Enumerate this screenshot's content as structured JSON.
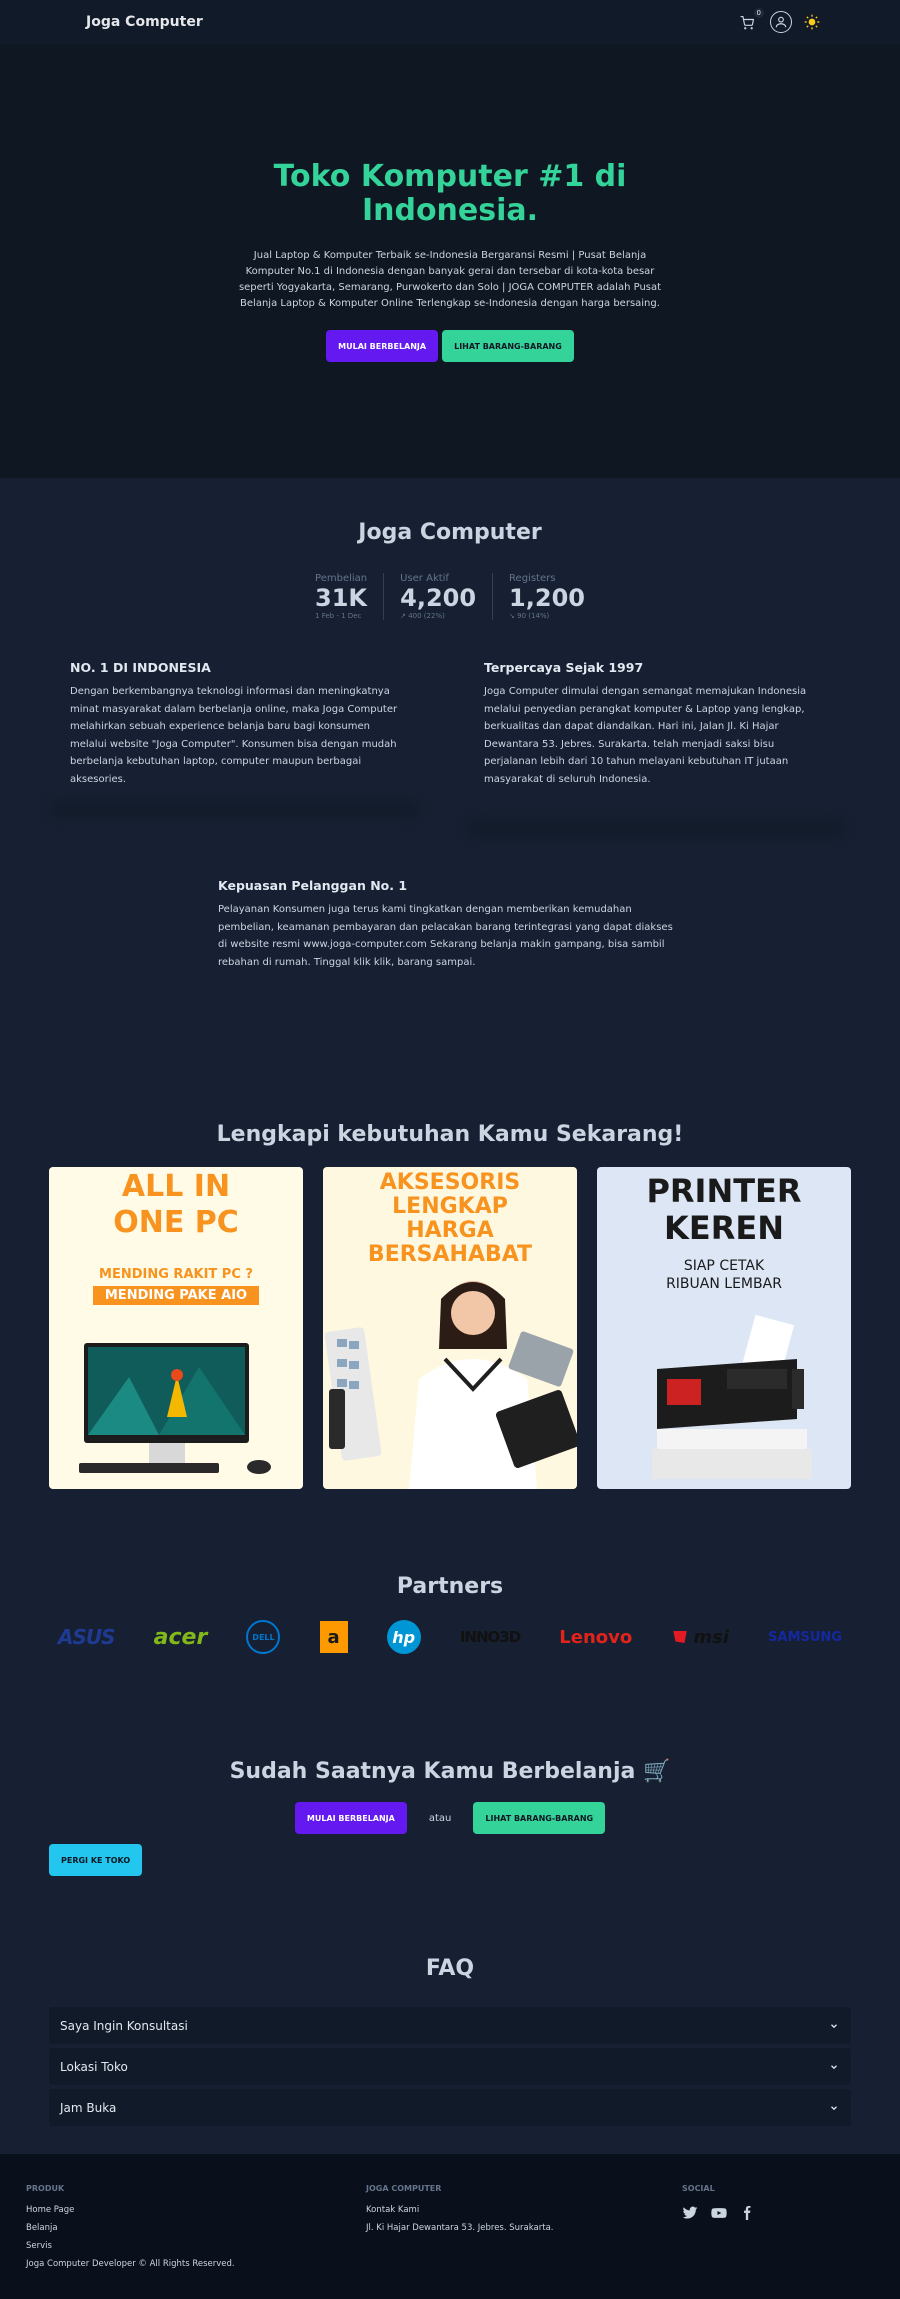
{
  "navbar": {
    "brand": "Joga Computer",
    "cart_count": "0"
  },
  "hero": {
    "title": "Toko Komputer #1 di Indonesia.",
    "description": "Jual Laptop & Komputer Terbaik se-Indonesia Bergaransi Resmi | Pusat Belanja Komputer No.1 di Indonesia dengan banyak gerai dan tersebar di kota-kota besar seperti Yogyakarta, Semarang, Purwokerto dan Solo | JOGA COMPUTER adalah Pusat Belanja Laptop & Komputer Online Terlengkap se-Indonesia dengan harga bersaing.",
    "primary_button": "MULAI BERBELANJA",
    "secondary_button": "LIHAT BARANG-BARANG"
  },
  "stats": {
    "title": "Joga Computer",
    "items": [
      {
        "title": "Pembelian",
        "value": "31K",
        "desc": "1 Feb - 1 Dec"
      },
      {
        "title": "User Aktif",
        "value": "4,200",
        "desc": "↗︎ 400 (22%)"
      },
      {
        "title": "Registers",
        "value": "1,200",
        "desc": "↘︎ 90 (14%)"
      }
    ]
  },
  "features": [
    {
      "title": "NO. 1 DI INDONESIA",
      "text": "Dengan berkembangnya teknologi informasi dan meningkatnya minat masyarakat dalam berbelanja online, maka Joga Computer melahirkan sebuah experience belanja baru bagi konsumen melalui website \"Joga Computer\". Konsumen bisa dengan mudah berbelanja kebutuhan laptop, computer maupun berbagai aksesories."
    },
    {
      "title": "Terpercaya Sejak 1997",
      "text": "Joga Computer dimulai dengan semangat memajukan Indonesia melalui penyedian perangkat komputer & Laptop yang lengkap, berkualitas dan dapat diandalkan. Hari ini, Jalan Jl. Ki Hajar Dewantara 53. Jebres. Surakarta. telah menjadi saksi bisu perjalanan lebih dari 10 tahun melayani kebutuhan IT jutaan masyarakat di seluruh Indonesia."
    },
    {
      "title": "Kepuasan Pelanggan No. 1",
      "text": "Pelayanan Konsumen juga terus kami tingkatkan dengan memberikan kemudahan pembelian, keamanan pembayaran dan pelacakan barang terintegrasi yang dapat diakses di website resmi www.joga-computer.com Sekarang belanja makin gampang, bisa sambil rebahan di rumah. Tinggal klik klik, barang sampai."
    }
  ],
  "products": {
    "title": "Lengkapi kebutuhan Kamu Sekarang!",
    "cards": [
      {
        "line1": "ALL IN",
        "line2": "ONE PC",
        "sub1": "MENDING RAKIT PC ?",
        "sub2": "MENDING PAKE AIO"
      },
      {
        "line1": "AKSESORIS",
        "line2": "LENGKAP",
        "line3": "HARGA",
        "line4": "BERSAHABAT"
      },
      {
        "line1": "PRINTER",
        "line2": "KEREN",
        "sub1": "SIAP CETAK",
        "sub2": "RIBUAN LEMBAR"
      }
    ]
  },
  "partners": {
    "title": "Partners",
    "logos": [
      "ASUS",
      "acer",
      "DELL",
      "a",
      "hp",
      "INNO3D",
      "Lenovo",
      "msi",
      "SAMSUNG"
    ]
  },
  "cta": {
    "title": "Sudah Saatnya Kamu Berbelanja 🛒",
    "primary_button": "MULAI BERBELANJA",
    "or_text": "atau",
    "secondary_button": "LIHAT BARANG-BARANG",
    "store_button": "PERGI KE TOKO"
  },
  "faq": {
    "title": "FAQ",
    "items": [
      "Saya Ingin Konsultasi",
      "Lokasi Toko",
      "Jam Buka"
    ]
  },
  "footer": {
    "col1": {
      "head": "PRODUK",
      "links": [
        "Home Page",
        "Belanja",
        "Servis"
      ],
      "copyright": "Joga Computer Developer © All Rights Reserved."
    },
    "col2": {
      "head": "JOGA COMPUTER",
      "links": [
        "Kontak Kami",
        "Jl. Ki Hajar Dewantara 53. Jebres. Surakarta."
      ]
    },
    "col3": {
      "head": "SOCIAL"
    }
  },
  "colors": {
    "accent_green": "#34d399",
    "accent_purple": "#6419f0",
    "accent_cyan": "#22c6ef",
    "background": "#162032"
  }
}
